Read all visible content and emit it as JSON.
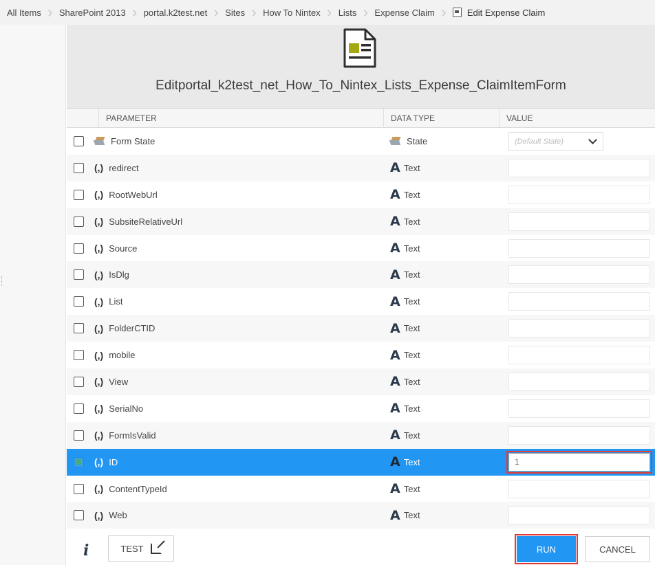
{
  "breadcrumb": {
    "items": [
      "All Items",
      "SharePoint 2013",
      "portal.k2test.net",
      "Sites",
      "How To Nintex",
      "Lists",
      "Expense Claim"
    ],
    "current": "Edit Expense Claim"
  },
  "header": {
    "title": "Editportal_k2test_net_How_To_Nintex_Lists_Expense_ClaimItemForm"
  },
  "table": {
    "columns": [
      "PARAMETER",
      "DATA TYPE",
      "VALUE"
    ],
    "state_placeholder": "(Default State)",
    "rows": [
      {
        "name": "Form State",
        "type": "State"
      },
      {
        "name": "redirect",
        "type": "Text"
      },
      {
        "name": "RootWebUrl",
        "type": "Text"
      },
      {
        "name": "SubsiteRelativeUrl",
        "type": "Text"
      },
      {
        "name": "Source",
        "type": "Text"
      },
      {
        "name": "IsDlg",
        "type": "Text"
      },
      {
        "name": "List",
        "type": "Text"
      },
      {
        "name": "FolderCTID",
        "type": "Text"
      },
      {
        "name": "mobile",
        "type": "Text"
      },
      {
        "name": "View",
        "type": "Text"
      },
      {
        "name": "SerialNo",
        "type": "Text"
      },
      {
        "name": "FormIsValid",
        "type": "Text"
      },
      {
        "name": "ID",
        "type": "Text",
        "value": "1"
      },
      {
        "name": "ContentTypeId",
        "type": "Text"
      },
      {
        "name": "Web",
        "type": "Text"
      }
    ],
    "param_glyph": "(,)",
    "text_glyph": "A"
  },
  "footer": {
    "info": "i",
    "test_label": "TEST",
    "run_label": "RUN",
    "cancel_label": "CANCEL"
  },
  "colors": {
    "selected_row": "#2196f3",
    "highlight": "#e53935",
    "run_button": "#2196f3"
  }
}
